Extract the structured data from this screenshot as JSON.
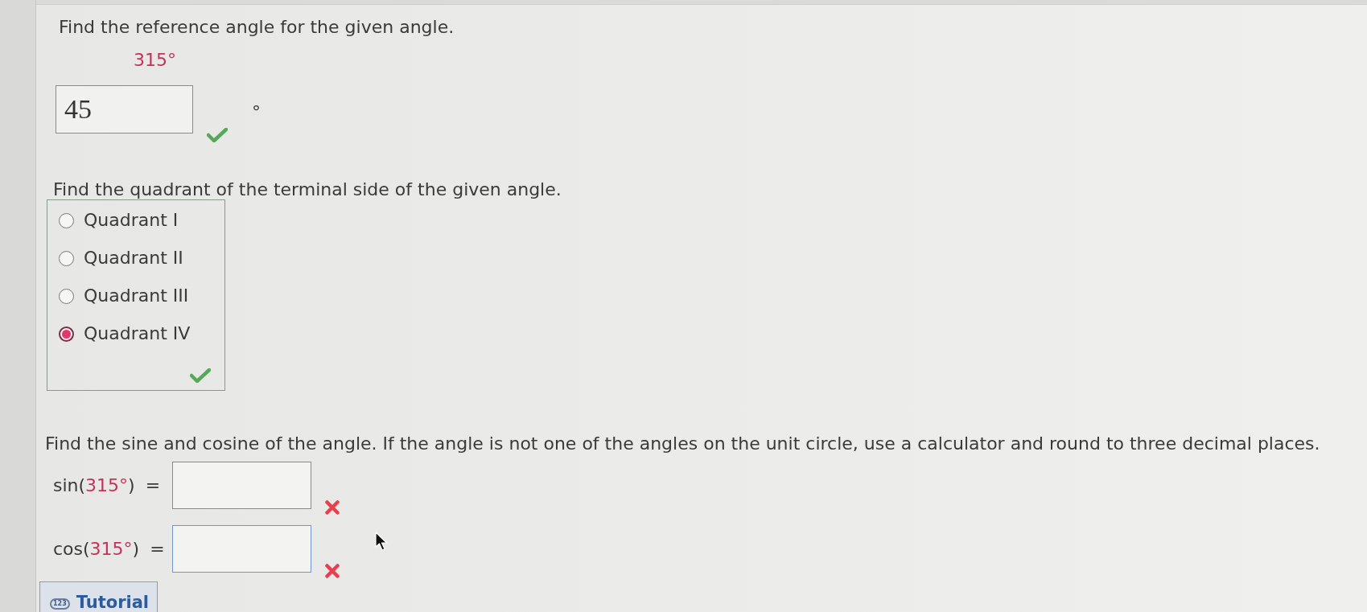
{
  "reference_angle": {
    "prompt": "Find the reference angle for the given angle.",
    "angle": "315°",
    "answer": {
      "value": "45",
      "focused": false,
      "correct": true
    },
    "unit": "°"
  },
  "quadrant": {
    "prompt": "Find the quadrant of the terminal side of the given angle.",
    "options": [
      {
        "label": "Quadrant I",
        "selected": false
      },
      {
        "label": "Quadrant II",
        "selected": false
      },
      {
        "label": "Quadrant III",
        "selected": false
      },
      {
        "label": "Quadrant IV",
        "selected": true
      }
    ],
    "correct": true
  },
  "sine_cosine": {
    "prompt": "Find the sine and cosine of the angle. If the angle is not one of the angles on the unit circle, use a calculator and round to three decimal places.",
    "rows": [
      {
        "label_before": "sin(",
        "angle": "315°",
        "label_after": ")",
        "equals": "=",
        "answer": {
          "focused": false,
          "correct": false
        }
      },
      {
        "label_before": "cos(",
        "angle": "315°",
        "label_after": ")",
        "equals": "=",
        "answer": {
          "focused": true,
          "correct": false
        }
      }
    ]
  },
  "tutorial_button": {
    "badge": "123",
    "label": "Tutorial"
  }
}
